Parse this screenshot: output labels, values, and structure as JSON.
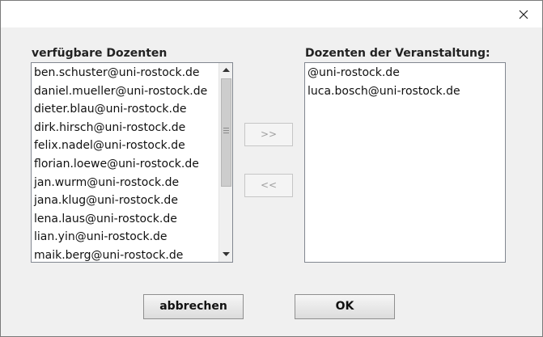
{
  "dialog": {
    "close_glyph": "×"
  },
  "available": {
    "label": "verfügbare Dozenten",
    "items": [
      "ben.schuster@uni-rostock.de",
      "daniel.mueller@uni-rostock.de",
      "dieter.blau@uni-rostock.de",
      "dirk.hirsch@uni-rostock.de",
      "felix.nadel@uni-rostock.de",
      "florian.loewe@uni-rostock.de",
      "jan.wurm@uni-rostock.de",
      "jana.klug@uni-rostock.de",
      "lena.laus@uni-rostock.de",
      "lian.yin@uni-rostock.de",
      "maik.berg@uni-rostock.de"
    ]
  },
  "assigned": {
    "label": "Dozenten der Veranstaltung:",
    "items": [
      "@uni-rostock.de",
      "luca.bosch@uni-rostock.de"
    ]
  },
  "transfer": {
    "add_label": ">>",
    "remove_label": "<<"
  },
  "actions": {
    "cancel_label": "abbrechen",
    "ok_label": "OK"
  }
}
